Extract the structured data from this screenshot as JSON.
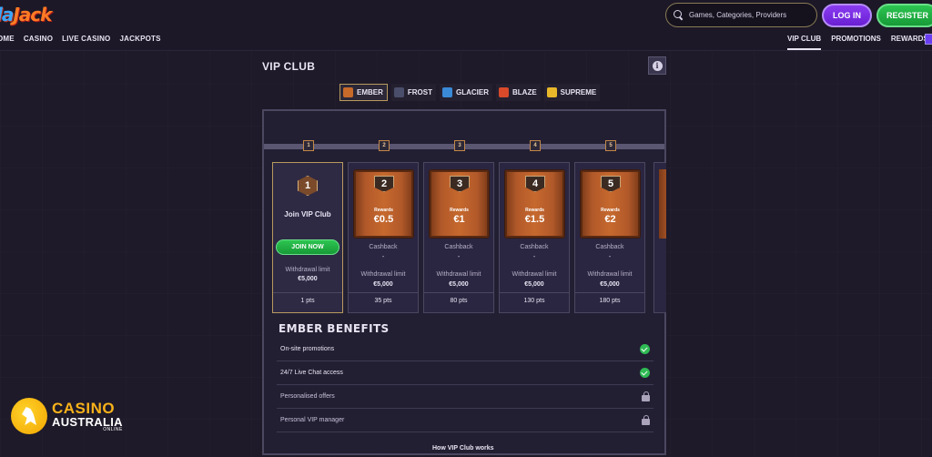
{
  "header": {
    "logo_left": "la",
    "logo_right": "Jack",
    "nav_left": [
      "OME",
      "CASINO",
      "LIVE CASINO",
      "JACKPOTS"
    ],
    "nav_right": [
      "VIP CLUB",
      "PROMOTIONS",
      "REWARDS"
    ],
    "search_placeholder": "Games, Categories, Providers",
    "login_label": "LOG IN",
    "register_label": "REGISTER"
  },
  "page": {
    "title": "VIP CLUB",
    "info_icon": "i"
  },
  "tiers": [
    {
      "label": "EMBER",
      "color": "#c86a2a",
      "active": true
    },
    {
      "label": "FROST",
      "color": "#4a4e6a",
      "active": false
    },
    {
      "label": "GLACIER",
      "color": "#3a8ad8",
      "active": false
    },
    {
      "label": "BLAZE",
      "color": "#d84a2a",
      "active": false
    },
    {
      "label": "SUPREME",
      "color": "#e8b82a",
      "active": false
    }
  ],
  "steps": [
    "1",
    "2",
    "3",
    "4",
    "5"
  ],
  "join_card": {
    "level": "1",
    "title": "Join VIP Club",
    "button": "JOIN NOW",
    "withdrawal_label": "Withdrawal limit",
    "withdrawal_value": "€5,000",
    "points": "1 pts"
  },
  "levels": [
    {
      "level": "2",
      "rewards_label": "Rewards",
      "reward": "€0.5",
      "cashback_label": "Cashback",
      "cashback": "-",
      "withdrawal_label": "Withdrawal limit",
      "withdrawal_value": "€5,000",
      "points": "35 pts"
    },
    {
      "level": "3",
      "rewards_label": "Rewards",
      "reward": "€1",
      "cashback_label": "Cashback",
      "cashback": "-",
      "withdrawal_label": "Withdrawal limit",
      "withdrawal_value": "€5,000",
      "points": "80 pts"
    },
    {
      "level": "4",
      "rewards_label": "Rewards",
      "reward": "€1.5",
      "cashback_label": "Cashback",
      "cashback": "-",
      "withdrawal_label": "Withdrawal limit",
      "withdrawal_value": "€5,000",
      "points": "130 pts"
    },
    {
      "level": "5",
      "rewards_label": "Rewards",
      "reward": "€2",
      "cashback_label": "Cashback",
      "cashback": "-",
      "withdrawal_label": "Withdrawal limit",
      "withdrawal_value": "€5,000",
      "points": "180 pts"
    }
  ],
  "benefits": {
    "title": "EMBER BENEFITS",
    "items": [
      {
        "label": "On-site promotions",
        "status": "check-icon"
      },
      {
        "label": "24/7 Live Chat access",
        "status": "check-icon"
      },
      {
        "label": "Personalised offers",
        "status": "lock-icon"
      },
      {
        "label": "Personal VIP manager",
        "status": "lock-icon"
      }
    ]
  },
  "footer_link": "How VIP Club works",
  "watermark": {
    "line1": "CASINO",
    "line2": "AUSTRALIA",
    "line3": "ONLINE"
  }
}
